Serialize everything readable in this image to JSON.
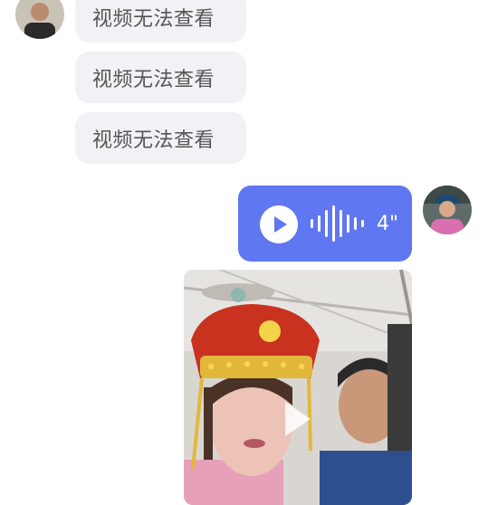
{
  "messages": {
    "received": [
      {
        "text": "视频无法查看"
      },
      {
        "text": "视频无法查看"
      },
      {
        "text": "视频无法查看"
      }
    ],
    "voice": {
      "duration": "4\""
    }
  },
  "colors": {
    "voice_bubble": "#5f77f1",
    "incoming_bubble": "#f2f1f5"
  }
}
